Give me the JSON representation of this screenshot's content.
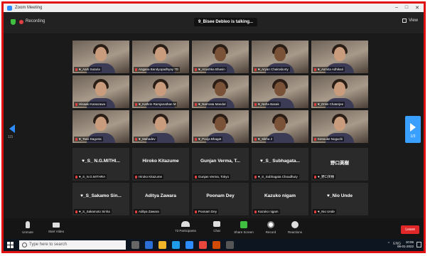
{
  "window": {
    "title": "Zoom Meeting",
    "controls": [
      "–",
      "□",
      "✕"
    ]
  },
  "topbar": {
    "recording_label": "Recording",
    "active_speaker": "9_Bisee Debleo is talking...",
    "view_label": "View"
  },
  "participants": [
    {
      "name": "♥_Aarti Sutaria",
      "video": true
    },
    {
      "name": "Angana Bandyopadhyay 7D",
      "video": true
    },
    {
      "name": "♥_Anushka Bhasin",
      "video": true
    },
    {
      "name": "♥_Aryan Chakraborty",
      "video": true
    },
    {
      "name": "♥_Asmita Adhikari",
      "video": true
    },
    {
      "name": "Hisaaki Kanazawa",
      "video": true
    },
    {
      "name": "♥_Kathrin Ramjanathan M",
      "video": true
    },
    {
      "name": "♥_Namrata Mandal",
      "video": true
    },
    {
      "name": "♥_Neha Basak",
      "video": true
    },
    {
      "name": "♥_Dristi Chaterjee",
      "video": true
    },
    {
      "name": "♥_Tanii Dagotra",
      "video": true
    },
    {
      "name": "♥_Mahadev",
      "video": true
    },
    {
      "name": "♥_Pooja Bhagat",
      "video": true
    },
    {
      "name": "♥_Sikha 2",
      "video": true
    },
    {
      "name": "Kensuke Noguchi",
      "video": true
    },
    {
      "name": "♥_S_ N.G.MITHI...",
      "label": "♥_S_N.G.MITHRA",
      "video": false
    },
    {
      "name": "Hiroko Kitazume",
      "label": "Hiroko Kitazume",
      "video": false
    },
    {
      "name": "Gunjan Verma, T...",
      "label": "Gunjan Verma, Tokyo",
      "video": false
    },
    {
      "name": "♥_S_ Subhagata...",
      "label": "♥_S_Subhagata Choudhury",
      "video": false
    },
    {
      "name": "野口英樹",
      "label": "♥_野口英樹",
      "video": false
    },
    {
      "name": "♥_S_Sakamo Sin...",
      "label": "♥_S_Sakamoto Sinha",
      "video": false
    },
    {
      "name": "Aditya Zawara",
      "label": "Aditya Zawara",
      "video": false
    },
    {
      "name": "Poonam Dey",
      "label": "Poonam Dey",
      "video": false
    },
    {
      "name": "Kazuko nigam",
      "label": "Kazuko nigam",
      "video": false
    },
    {
      "name": "♥_Nio Unde",
      "label": "♥_Nio Unde",
      "video": false
    }
  ],
  "paging": {
    "left_page": "1/3",
    "right_page": "1/3"
  },
  "toolbar": {
    "unmute": "Unmute",
    "start_video": "Start Video",
    "participants_count": "73",
    "participants": "Participants",
    "chat": "Chat",
    "share_screen": "Share Screen",
    "record": "Record",
    "reactions": "Reactions",
    "leave": "Leave"
  },
  "taskbar": {
    "search_placeholder": "Type here to search",
    "time": "10:06",
    "date": "06-01-2022",
    "tray": "ENG"
  },
  "colors": {
    "accent": "#2d8cff",
    "leave": "#e02828",
    "border": "#e01010",
    "share": "#3fbf3f"
  }
}
